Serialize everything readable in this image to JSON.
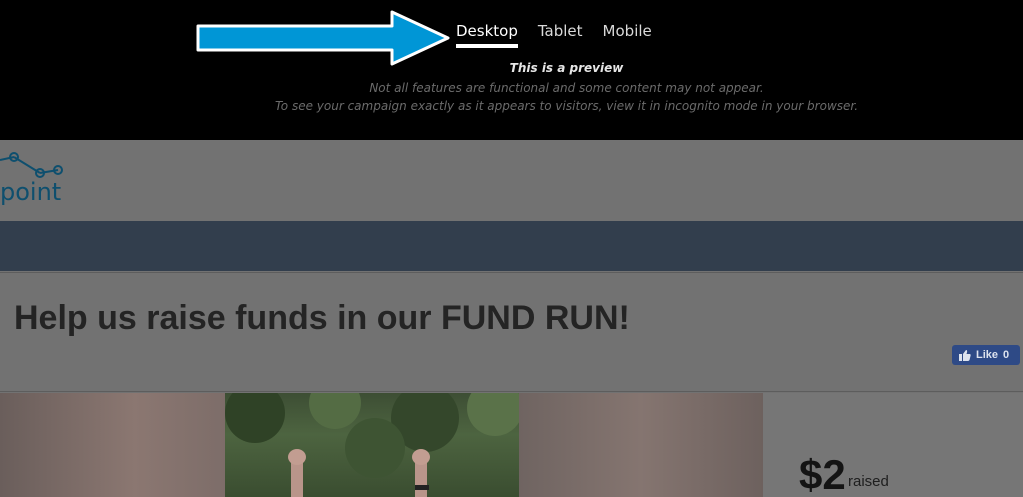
{
  "preview": {
    "tabs": [
      {
        "label": "Desktop",
        "active": true
      },
      {
        "label": "Tablet",
        "active": false
      },
      {
        "label": "Mobile",
        "active": false
      }
    ],
    "title": "This is a preview",
    "line1": "Not all features are functional and some content may not appear.",
    "line2": "To see your campaign exactly as it appears to visitors, view it in incognito mode in your browser.",
    "arrow_color": "#0096d6"
  },
  "campaign": {
    "logo_text": "point",
    "title": "Help us raise funds in our FUND RUN!",
    "like_button": {
      "label": "Like",
      "count": "0"
    },
    "raised": {
      "amount": "$2",
      "label": "raised"
    },
    "nav_color": "#323e4d"
  }
}
